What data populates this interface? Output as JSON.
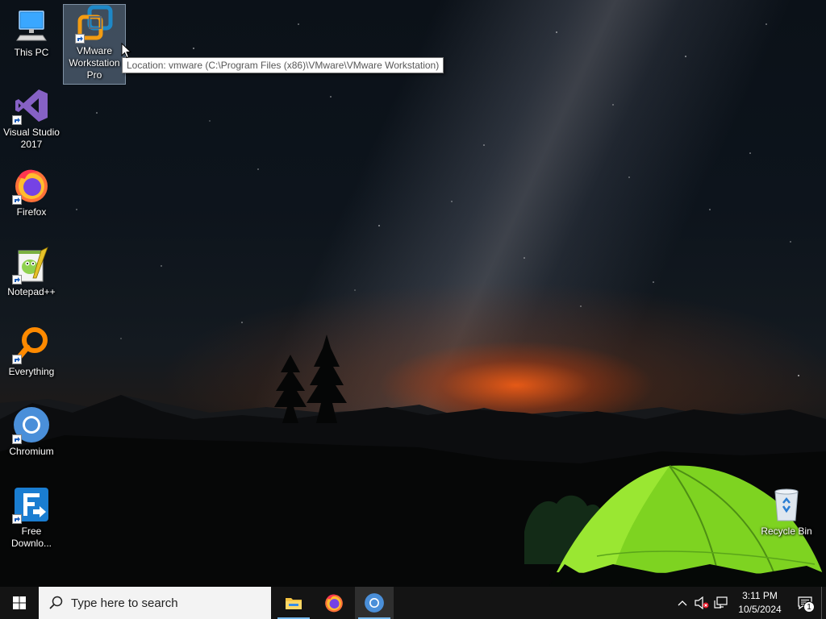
{
  "desktop": {
    "icons": [
      {
        "label": "This PC",
        "icon": "this-pc-icon"
      },
      {
        "label": "VMware Workstation Pro",
        "icon": "vmware-icon",
        "selected": true
      },
      {
        "label": "Visual Studio 2017",
        "icon": "visual-studio-icon"
      },
      {
        "label": "Firefox",
        "icon": "firefox-icon"
      },
      {
        "label": "Notepad++",
        "icon": "notepadpp-icon"
      },
      {
        "label": "Everything",
        "icon": "everything-icon"
      },
      {
        "label": "Chromium",
        "icon": "chromium-icon"
      },
      {
        "label": "Free Downlo...",
        "icon": "free-download-manager-icon"
      },
      {
        "label": "Recycle Bin",
        "icon": "recycle-bin-icon"
      }
    ],
    "tooltip": "Location: vmware (C:\\Program Files (x86)\\VMware\\VMware Workstation)"
  },
  "taskbar": {
    "search_placeholder": "Type here to search",
    "pinned": [
      {
        "name": "File Explorer",
        "icon": "file-explorer-icon"
      },
      {
        "name": "Firefox",
        "icon": "firefox-icon"
      },
      {
        "name": "Chromium",
        "icon": "chromium-icon",
        "active": true
      }
    ],
    "tray": {
      "time": "3:11 PM",
      "date": "10/5/2024",
      "notification_count": "1"
    }
  },
  "colors": {
    "taskbar": "#141414",
    "search_box": "#f3f3f3",
    "tent": "#7ed321",
    "horizon_glow": "#ff6014"
  }
}
